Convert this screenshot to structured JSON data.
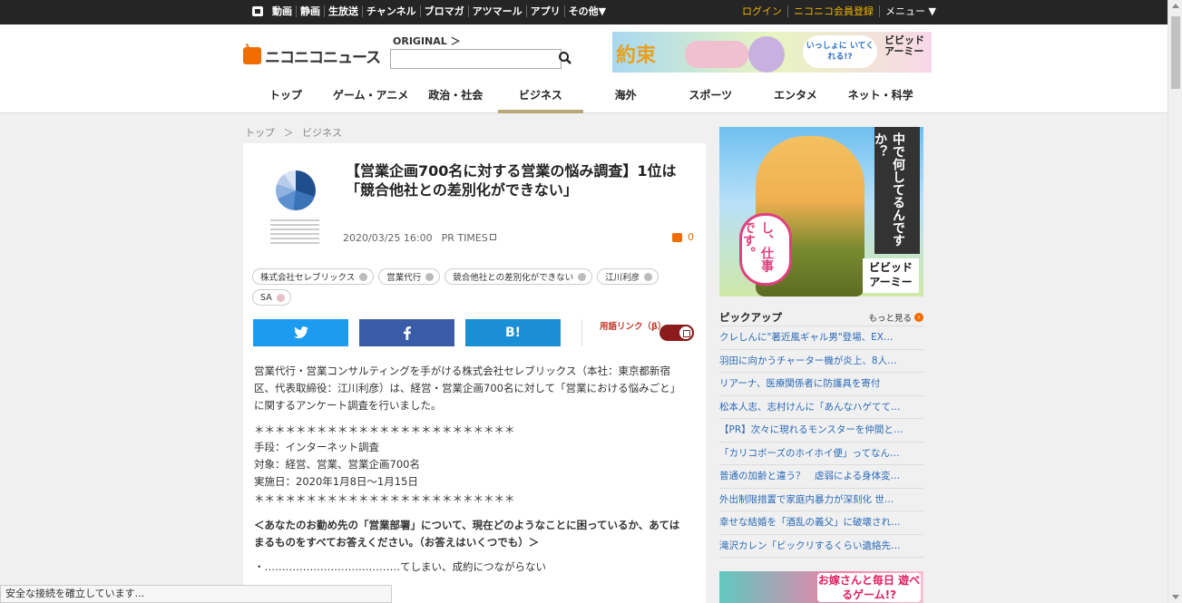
{
  "globalbar": {
    "items": [
      "動画",
      "静画",
      "生放送",
      "チャンネル",
      "ブロマガ",
      "アツマール",
      "アプリ",
      "その他▼"
    ],
    "login": "ログイン",
    "register": "ニコニコ会員登録",
    "menu": "メニュー ▼"
  },
  "header": {
    "logo": "ニコニコニュース",
    "original": "ORIGINAL ＞",
    "search_value": ""
  },
  "banner_top": {
    "t1": "約束",
    "t2": "いっしょに いてくれる!?",
    "t3": "ビビッド アーミー"
  },
  "nav": [
    "トップ",
    "ゲーム・アニメ",
    "政治・社会",
    "ビジネス",
    "海外",
    "スポーツ",
    "エンタメ",
    "ネット・科学"
  ],
  "breadcrumb": {
    "home": "トップ",
    "sep": "＞",
    "current": "ビジネス"
  },
  "article": {
    "title": "【営業企画700名に対する営業の悩み調査】1位は「競合他社との差別化ができない」",
    "date": "2020/03/25 16:00",
    "source": "PR TIMES",
    "comments": "0",
    "tags": [
      "株式会社セレブリックス",
      "営業代行",
      "競合他社との差別化ができない",
      "江川利彦",
      "SA"
    ],
    "glossary": "用語リンク（β）",
    "body1": "営業代行・営業コンサルティングを手がける株式会社セレブリックス（本社：東京都新宿区、代表取締役：江川利彦）は、経営・営業企画700名に対して「営業における悩みごと」に関するアンケート調査を行いました。",
    "stars": "＊＊＊＊＊＊＊＊＊＊＊＊＊＊＊＊＊＊＊＊＊＊＊＊＊",
    "method": "手段：インターネット調査",
    "target": "対象：経営、営業、営業企画700名",
    "period": "実施日：2020年1月8日～1月15日",
    "question": "＜あなたのお勤め先の「営業部署」について、現在どのようなことに困っているか、あてはまるものをすべてお答えください。（お答えはいくつでも）＞",
    "answer1": "・…………………………………てしまい、成約につながらない"
  },
  "sidebar": {
    "ad_vertical": "中で何してるんですか？",
    "ad_bubble": "し、仕事です。",
    "ad_logo": "ビビッド アーミー",
    "pickup_title": "ピックアップ",
    "more": "もっと見る",
    "pickup": [
      "クレしんに\"著近風ギャル男\"登場、EX…",
      "羽田に向かうチャーター機が炎上、8人…",
      "リアーナ、医療関係者に防護具を寄付",
      "松本人志、志村けんに「あんなハゲてて…",
      "【PR】次々に現れるモンスターを仲間と…",
      "「カリコボーズのホイホイ便」ってなん…",
      "普通の加齢と違う？　虐弱による身体変…",
      "外出制限措置で家庭内暴力が深刻化 世…",
      "幸せな結婚を「酒乱の義父」に破壊され…",
      "滝沢カレン「ビックリするくらい遺絡先…"
    ],
    "ad_bottom": "お嫁さんと毎日 遊べるゲーム!?"
  },
  "status": "安全な接続を確立しています..."
}
